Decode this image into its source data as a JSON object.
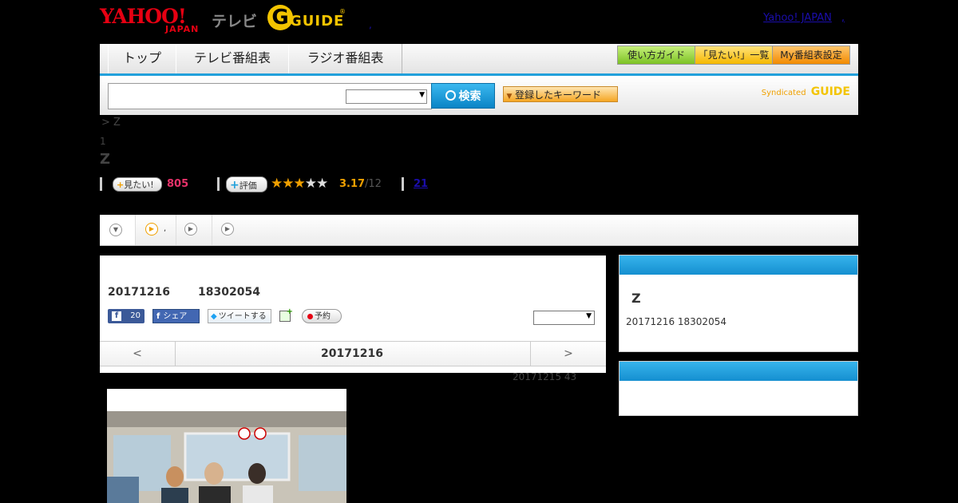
{
  "header": {
    "logo_yahoo": "YAHOO!",
    "logo_japan": "JAPAN",
    "logo_tv": "テレビ",
    "logo_g": "G",
    "logo_guide": "GUIDE",
    "logo_reg": "®",
    "dot": ",",
    "yahoo_japan_link": "Yahoo! JAPAN",
    "link_sep": ","
  },
  "nav": {
    "tabs": [
      "トップ",
      "テレビ番組表",
      "ラジオ番組表"
    ],
    "right_buttons": [
      "使い方ガイド",
      "「見たい!」一覧",
      "My番組表設定"
    ]
  },
  "search": {
    "button_label": "検索",
    "keyword_button": "登録したキーワード",
    "syndicated": "Syndicated",
    "syndicated_logo": "GUIDE"
  },
  "program": {
    "breadcrumb": "> Z",
    "rank": "1",
    "title": "Z",
    "want_label": "見たい!",
    "want_count": "805",
    "rate_label": "評価",
    "rating_value": "3.17",
    "rating_count": "/12",
    "review_link": "21",
    "stars": 3
  },
  "main": {
    "date": "20171216",
    "time": "18302054",
    "facebook_count": "20",
    "share_label": "シェア",
    "tweet_label": "ツイートする",
    "reserve_label": "予約",
    "pager_prev": "<",
    "pager_date": "20171216",
    "pager_next": ">",
    "update_note": "20171215  43"
  },
  "sidebar": {
    "title": "Z",
    "datetime": "20171216  18302054"
  },
  "colors": {
    "accent": "#21a0db",
    "want_count": "#e8326a",
    "rating": "#f0a000",
    "link": "#1a0dab"
  }
}
